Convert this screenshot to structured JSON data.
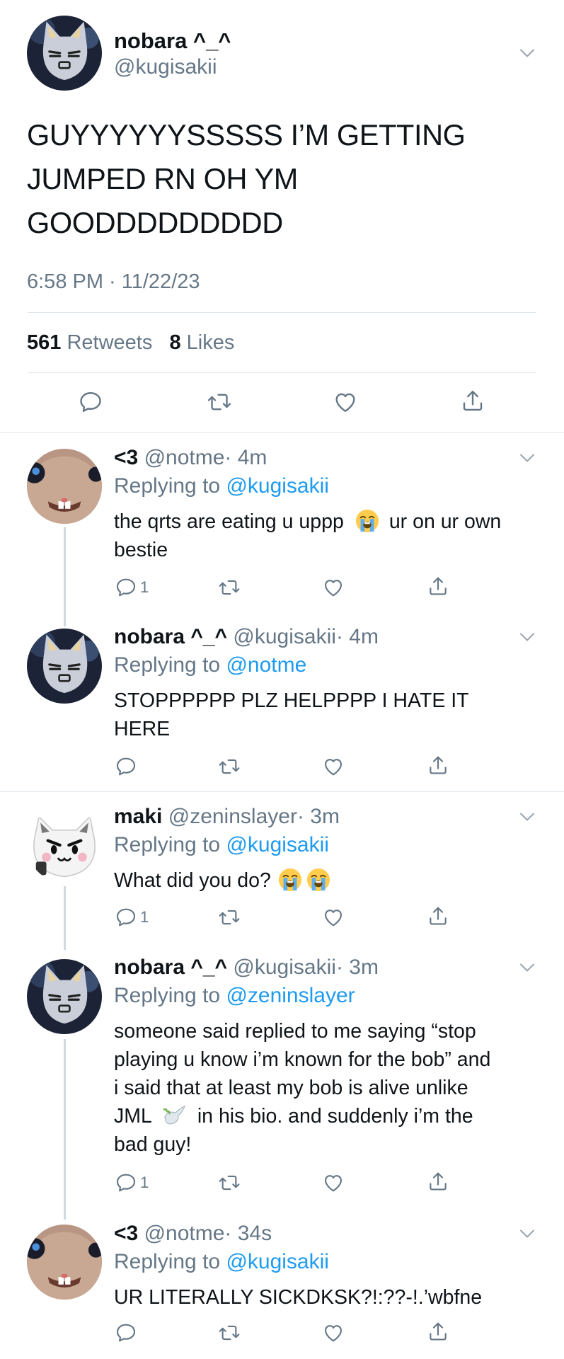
{
  "main": {
    "author_name": "nobara ^_^",
    "author_handle": "@kugisakii",
    "text_line1": "GUYYYYYYSSSSS I’M GETTING",
    "text_line2": "JUMPED RN OH YM",
    "text_line3": "GOODDDDDDDDD",
    "timestamp": "6:58 PM · 11/22/23",
    "retweet_count": "561",
    "retweet_label": "Retweets",
    "like_count": "8",
    "like_label": "Likes"
  },
  "replies": [
    {
      "name": "<3",
      "handle": "@notme",
      "time": "· 4m",
      "replying_label": "Replying to",
      "replying_to": "@kugisakii",
      "text_line1_a": "the qrts are eating u uppp",
      "text_line1_b": "ur on ur own",
      "text_line2": "bestie",
      "reply_count": "1"
    },
    {
      "name": "nobara ^_^",
      "handle": "@kugisakii",
      "time": "· 4m",
      "replying_label": "Replying to",
      "replying_to": "@notme",
      "text_line1": "STOPPPPPP PLZ HELPPPP I HATE IT",
      "text_line2": "HERE"
    },
    {
      "name": "maki",
      "handle": "@zeninslayer",
      "time": "· 3m",
      "replying_label": "Replying to",
      "replying_to": "@kugisakii",
      "text_line1": "What did you do?",
      "reply_count": "1"
    },
    {
      "name": "nobara ^_^",
      "handle": "@kugisakii",
      "time": "· 3m",
      "replying_label": "Replying to",
      "replying_to": "@zeninslayer",
      "text_line1": "someone said replied to me saying “stop",
      "text_line2": "playing u know i’m known for the bob” and",
      "text_line3": "i said that at least my bob is alive unlike",
      "text_line4_a": "JML",
      "text_line4_b": "in his bio. and suddenly i’m the",
      "text_line5": "bad guy!",
      "reply_count": "1"
    },
    {
      "name": "<3",
      "handle": "@notme",
      "time": "· 34s",
      "replying_label": "Replying to",
      "replying_to": "@kugisakii",
      "text_line1": "UR LITERALLY SICKDKSK?!:??-!.’wbfne"
    }
  ],
  "icons": {
    "reply": "reply-icon",
    "retweet": "retweet-icon",
    "like": "heart-icon",
    "share": "share-icon",
    "more": "chevron-down-icon"
  },
  "colors": {
    "link": "#1d9bf0",
    "secondary": "#657786",
    "divider": "#e1e8ed"
  }
}
